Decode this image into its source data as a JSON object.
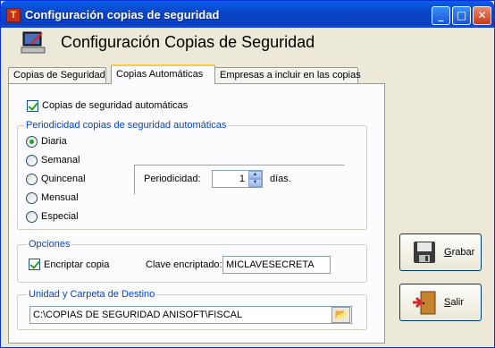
{
  "window": {
    "title": "Configuración copias de seguridad"
  },
  "header": {
    "title": "Configuración Copias de Seguridad"
  },
  "tabs": [
    {
      "label": "Copias de Seguridad"
    },
    {
      "label": "Copias Automáticas"
    },
    {
      "label": "Empresas a incluir en las copias"
    }
  ],
  "auto_backup": {
    "label": "Copias de seguridad automáticas",
    "checked": true
  },
  "periodicity_group": {
    "title": "Periodicidad copias  de seguridad automáticas",
    "options": [
      {
        "label": "Diaria",
        "selected": true
      },
      {
        "label": "Semanal",
        "selected": false
      },
      {
        "label": "Quincenal",
        "selected": false
      },
      {
        "label": "Mensual",
        "selected": false
      },
      {
        "label": "Especial",
        "selected": false
      }
    ],
    "periodicity_label": "Periodicidad:",
    "periodicity_value": "1",
    "unit": "días."
  },
  "options_group": {
    "title": "Opciones",
    "encrypt_label": "Encriptar copia",
    "encrypt_checked": true,
    "key_label": "Clave encriptado:",
    "key_value": "MICLAVESECRETA"
  },
  "destination_group": {
    "title": "Unidad y Carpeta de Destino",
    "path": "C:\\COPIAS DE SEGURIDAD ANISOFT\\FISCAL"
  },
  "buttons": {
    "save": {
      "label": "Grabar",
      "accel": "G",
      "rest": "rabar"
    },
    "exit": {
      "label": "Salir",
      "accel": "S",
      "rest": "alir"
    }
  },
  "colors": {
    "titlebar": "#0a5ee9",
    "group_title": "#0046d5",
    "check": "#21a121"
  }
}
